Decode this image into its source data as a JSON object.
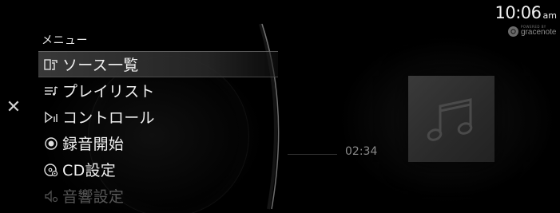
{
  "clock": {
    "time": "10:06",
    "ampm": "am"
  },
  "brand": {
    "powered_by": "POWERED BY",
    "name": "gracenote",
    "icon": "gracenote-logo-icon"
  },
  "close": {
    "glyph": "✕",
    "icon": "close-icon"
  },
  "menu": {
    "header": "メニュー",
    "items": [
      {
        "label": "ソース一覧",
        "icon": "source-list-icon",
        "selected": true,
        "faded": false
      },
      {
        "label": "プレイリスト",
        "icon": "playlist-icon",
        "selected": false,
        "faded": false
      },
      {
        "label": "コントロール",
        "icon": "control-icon",
        "selected": false,
        "faded": false
      },
      {
        "label": "録音開始",
        "icon": "record-icon",
        "selected": false,
        "faded": false
      },
      {
        "label": "CD設定",
        "icon": "cd-settings-icon",
        "selected": false,
        "faded": false
      },
      {
        "label": "音響設定",
        "icon": "sound-settings-icon",
        "selected": false,
        "faded": true
      }
    ]
  },
  "playback": {
    "elapsed": "02:34"
  },
  "album": {
    "icon": "music-note-icon"
  },
  "colors": {
    "background": "#000000",
    "text": "#f0f0f0",
    "selected_bar": "#3c3c3c",
    "muted": "#8a8a8a"
  }
}
